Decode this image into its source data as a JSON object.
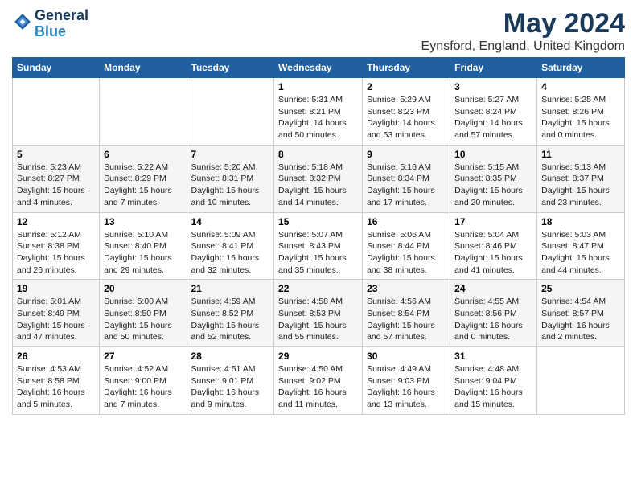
{
  "header": {
    "logo_line1": "General",
    "logo_line2": "Blue",
    "month_title": "May 2024",
    "location": "Eynsford, England, United Kingdom"
  },
  "weekdays": [
    "Sunday",
    "Monday",
    "Tuesday",
    "Wednesday",
    "Thursday",
    "Friday",
    "Saturday"
  ],
  "weeks": [
    [
      {
        "day": "",
        "sunrise": "",
        "sunset": "",
        "daylight": ""
      },
      {
        "day": "",
        "sunrise": "",
        "sunset": "",
        "daylight": ""
      },
      {
        "day": "",
        "sunrise": "",
        "sunset": "",
        "daylight": ""
      },
      {
        "day": "1",
        "sunrise": "Sunrise: 5:31 AM",
        "sunset": "Sunset: 8:21 PM",
        "daylight": "Daylight: 14 hours and 50 minutes."
      },
      {
        "day": "2",
        "sunrise": "Sunrise: 5:29 AM",
        "sunset": "Sunset: 8:23 PM",
        "daylight": "Daylight: 14 hours and 53 minutes."
      },
      {
        "day": "3",
        "sunrise": "Sunrise: 5:27 AM",
        "sunset": "Sunset: 8:24 PM",
        "daylight": "Daylight: 14 hours and 57 minutes."
      },
      {
        "day": "4",
        "sunrise": "Sunrise: 5:25 AM",
        "sunset": "Sunset: 8:26 PM",
        "daylight": "Daylight: 15 hours and 0 minutes."
      }
    ],
    [
      {
        "day": "5",
        "sunrise": "Sunrise: 5:23 AM",
        "sunset": "Sunset: 8:27 PM",
        "daylight": "Daylight: 15 hours and 4 minutes."
      },
      {
        "day": "6",
        "sunrise": "Sunrise: 5:22 AM",
        "sunset": "Sunset: 8:29 PM",
        "daylight": "Daylight: 15 hours and 7 minutes."
      },
      {
        "day": "7",
        "sunrise": "Sunrise: 5:20 AM",
        "sunset": "Sunset: 8:31 PM",
        "daylight": "Daylight: 15 hours and 10 minutes."
      },
      {
        "day": "8",
        "sunrise": "Sunrise: 5:18 AM",
        "sunset": "Sunset: 8:32 PM",
        "daylight": "Daylight: 15 hours and 14 minutes."
      },
      {
        "day": "9",
        "sunrise": "Sunrise: 5:16 AM",
        "sunset": "Sunset: 8:34 PM",
        "daylight": "Daylight: 15 hours and 17 minutes."
      },
      {
        "day": "10",
        "sunrise": "Sunrise: 5:15 AM",
        "sunset": "Sunset: 8:35 PM",
        "daylight": "Daylight: 15 hours and 20 minutes."
      },
      {
        "day": "11",
        "sunrise": "Sunrise: 5:13 AM",
        "sunset": "Sunset: 8:37 PM",
        "daylight": "Daylight: 15 hours and 23 minutes."
      }
    ],
    [
      {
        "day": "12",
        "sunrise": "Sunrise: 5:12 AM",
        "sunset": "Sunset: 8:38 PM",
        "daylight": "Daylight: 15 hours and 26 minutes."
      },
      {
        "day": "13",
        "sunrise": "Sunrise: 5:10 AM",
        "sunset": "Sunset: 8:40 PM",
        "daylight": "Daylight: 15 hours and 29 minutes."
      },
      {
        "day": "14",
        "sunrise": "Sunrise: 5:09 AM",
        "sunset": "Sunset: 8:41 PM",
        "daylight": "Daylight: 15 hours and 32 minutes."
      },
      {
        "day": "15",
        "sunrise": "Sunrise: 5:07 AM",
        "sunset": "Sunset: 8:43 PM",
        "daylight": "Daylight: 15 hours and 35 minutes."
      },
      {
        "day": "16",
        "sunrise": "Sunrise: 5:06 AM",
        "sunset": "Sunset: 8:44 PM",
        "daylight": "Daylight: 15 hours and 38 minutes."
      },
      {
        "day": "17",
        "sunrise": "Sunrise: 5:04 AM",
        "sunset": "Sunset: 8:46 PM",
        "daylight": "Daylight: 15 hours and 41 minutes."
      },
      {
        "day": "18",
        "sunrise": "Sunrise: 5:03 AM",
        "sunset": "Sunset: 8:47 PM",
        "daylight": "Daylight: 15 hours and 44 minutes."
      }
    ],
    [
      {
        "day": "19",
        "sunrise": "Sunrise: 5:01 AM",
        "sunset": "Sunset: 8:49 PM",
        "daylight": "Daylight: 15 hours and 47 minutes."
      },
      {
        "day": "20",
        "sunrise": "Sunrise: 5:00 AM",
        "sunset": "Sunset: 8:50 PM",
        "daylight": "Daylight: 15 hours and 50 minutes."
      },
      {
        "day": "21",
        "sunrise": "Sunrise: 4:59 AM",
        "sunset": "Sunset: 8:52 PM",
        "daylight": "Daylight: 15 hours and 52 minutes."
      },
      {
        "day": "22",
        "sunrise": "Sunrise: 4:58 AM",
        "sunset": "Sunset: 8:53 PM",
        "daylight": "Daylight: 15 hours and 55 minutes."
      },
      {
        "day": "23",
        "sunrise": "Sunrise: 4:56 AM",
        "sunset": "Sunset: 8:54 PM",
        "daylight": "Daylight: 15 hours and 57 minutes."
      },
      {
        "day": "24",
        "sunrise": "Sunrise: 4:55 AM",
        "sunset": "Sunset: 8:56 PM",
        "daylight": "Daylight: 16 hours and 0 minutes."
      },
      {
        "day": "25",
        "sunrise": "Sunrise: 4:54 AM",
        "sunset": "Sunset: 8:57 PM",
        "daylight": "Daylight: 16 hours and 2 minutes."
      }
    ],
    [
      {
        "day": "26",
        "sunrise": "Sunrise: 4:53 AM",
        "sunset": "Sunset: 8:58 PM",
        "daylight": "Daylight: 16 hours and 5 minutes."
      },
      {
        "day": "27",
        "sunrise": "Sunrise: 4:52 AM",
        "sunset": "Sunset: 9:00 PM",
        "daylight": "Daylight: 16 hours and 7 minutes."
      },
      {
        "day": "28",
        "sunrise": "Sunrise: 4:51 AM",
        "sunset": "Sunset: 9:01 PM",
        "daylight": "Daylight: 16 hours and 9 minutes."
      },
      {
        "day": "29",
        "sunrise": "Sunrise: 4:50 AM",
        "sunset": "Sunset: 9:02 PM",
        "daylight": "Daylight: 16 hours and 11 minutes."
      },
      {
        "day": "30",
        "sunrise": "Sunrise: 4:49 AM",
        "sunset": "Sunset: 9:03 PM",
        "daylight": "Daylight: 16 hours and 13 minutes."
      },
      {
        "day": "31",
        "sunrise": "Sunrise: 4:48 AM",
        "sunset": "Sunset: 9:04 PM",
        "daylight": "Daylight: 16 hours and 15 minutes."
      },
      {
        "day": "",
        "sunrise": "",
        "sunset": "",
        "daylight": ""
      }
    ]
  ]
}
